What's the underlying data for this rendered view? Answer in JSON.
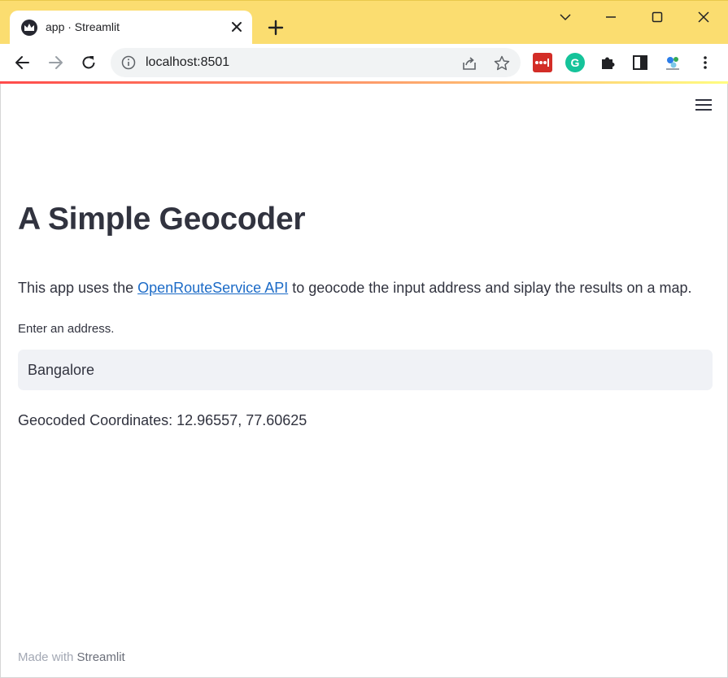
{
  "browser": {
    "tab": {
      "title": "app · Streamlit",
      "favicon": "streamlit-crown-icon"
    },
    "address_bar": {
      "url": "localhost:8501"
    },
    "extensions": [
      "lastpass-icon",
      "grammarly-icon",
      "puzzle-icon",
      "side-panel-icon",
      "profile-icon"
    ],
    "grammarly_letter": "G",
    "colors": {
      "titlebar": "#fbdd70",
      "omnibox": "#f1f3f4"
    }
  },
  "app": {
    "title": "A Simple Geocoder",
    "intro": {
      "before": "This app uses the ",
      "link_text": "OpenRouteService API",
      "after": " to geocode the input address and siplay the results on a map."
    },
    "address_input": {
      "label": "Enter an address.",
      "value": "Bangalore"
    },
    "result_text": "Geocoded Coordinates: 12.96557, 77.60625",
    "footer": {
      "prefix": "Made with ",
      "brand": "Streamlit"
    },
    "colors": {
      "text": "#31333f",
      "link": "#1c6bc7",
      "input_bg": "#f0f2f6",
      "footer": "#a3a8b4"
    }
  }
}
